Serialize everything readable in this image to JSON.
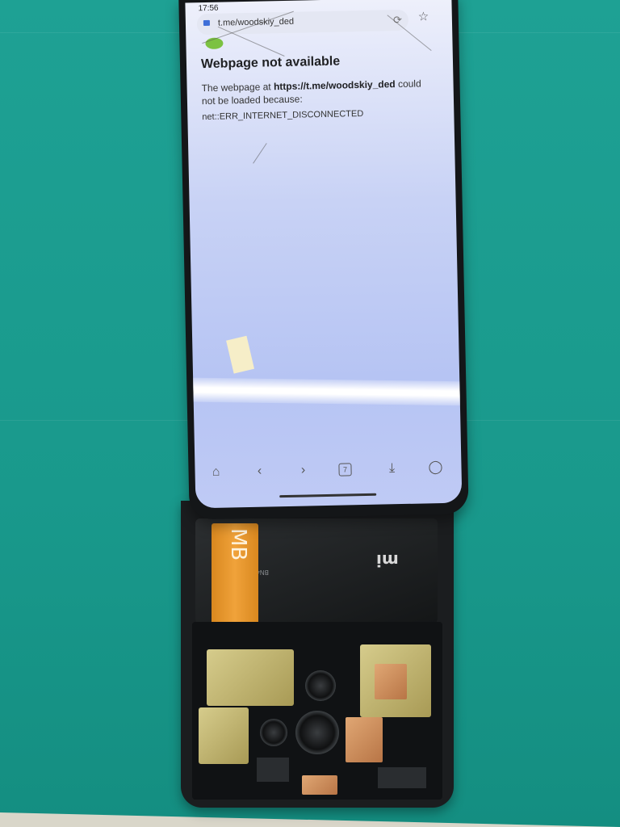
{
  "browser": {
    "status_time": "17:56",
    "url": "t.me/woodskiy_ded",
    "error_title": "Webpage not available",
    "error_prefix": "The webpage at",
    "error_url": "https://t.me/woodskiy_ded",
    "error_suffix": "could not be loaded because:",
    "error_code": "net::ERR_INTERNET_DISCONNECTED"
  },
  "device": {
    "flex_label": "MB",
    "battery_brand": "mi"
  },
  "icons": {
    "lock": "lock-icon",
    "reload": "reload-icon",
    "star": "star-icon",
    "home": "home-icon",
    "back": "back-icon",
    "forward": "forward-icon",
    "tabs": "tabs-icon",
    "downloads": "downloads-icon",
    "profile": "profile-icon"
  },
  "navbar": {
    "tabs_count": "7"
  },
  "colors": {
    "mat": "#1f9f92",
    "screen": "#c8d2f5",
    "flex": "#f0a23a",
    "shield": "#d6cc8c"
  }
}
